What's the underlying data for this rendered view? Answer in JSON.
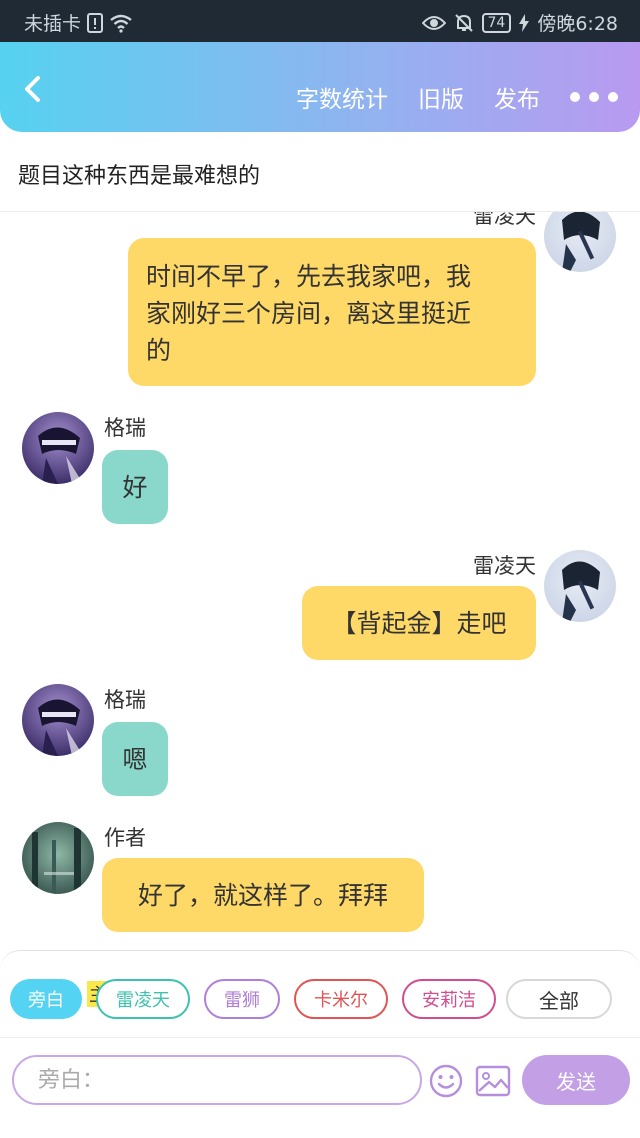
{
  "status_bar": {
    "carrier": "未插卡",
    "battery": "74",
    "time": "傍晚6:28",
    "icons": [
      "sim-alert-icon",
      "wifi-icon",
      "eye-icon",
      "bell-off-icon",
      "battery-icon",
      "charging-icon"
    ]
  },
  "header": {
    "back_icon": "chevron-left-icon",
    "actions": {
      "word_count": "字数统计",
      "old_version": "旧版",
      "publish": "发布"
    },
    "more_icon": "more-dots-icon",
    "gradient": [
      "#56d2f0",
      "#b99af0"
    ]
  },
  "title": "题目这种东西是最难想的",
  "messages": [
    {
      "side": "right",
      "name": "雷凌天",
      "text": [
        "时间不早了，先去我家吧，我",
        "家刚好三个房间，离这里挺近",
        "的"
      ],
      "color": "#ffd968"
    },
    {
      "side": "left",
      "name": "格瑞",
      "text": [
        "好"
      ],
      "color": "#8ad8cb"
    },
    {
      "side": "right",
      "name": "雷凌天",
      "text": [
        "【背起金】走吧"
      ],
      "color": "#ffd968"
    },
    {
      "side": "left",
      "name": "格瑞",
      "text": [
        "嗯"
      ],
      "color": "#8ad8cb"
    },
    {
      "side": "left",
      "name": "作者",
      "text": [
        "好了，就这样了。拜拜"
      ],
      "color": "#ffd968"
    }
  ],
  "roles": {
    "narration": "旁白",
    "main_tag": "主",
    "chips": [
      "雷凌天",
      "雷狮",
      "卡米尔",
      "安莉洁",
      "全部"
    ]
  },
  "composer": {
    "placeholder": "旁白：",
    "emoji_icon": "smiley-icon",
    "image_icon": "image-icon",
    "send": "发送"
  },
  "colors": {
    "narration_chip": "#55d3f2",
    "send_button": "#c39fe6",
    "chip_borders": [
      "#3cc2ae",
      "#b07fd8",
      "#e05454",
      "#d24d8e",
      "#d8d8d8"
    ]
  }
}
